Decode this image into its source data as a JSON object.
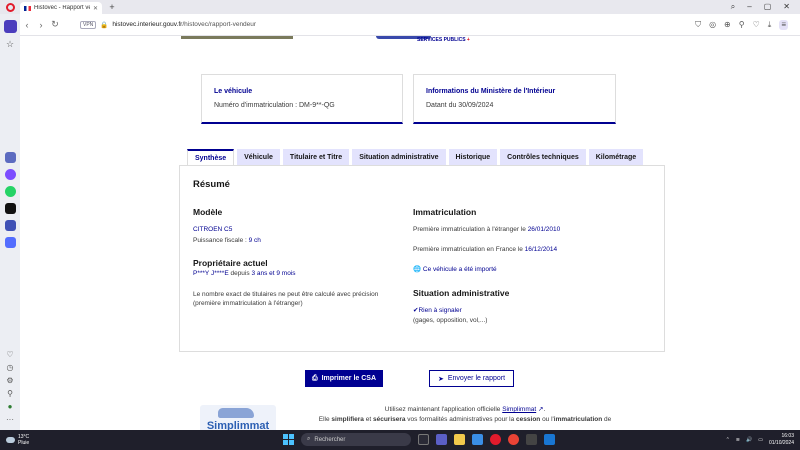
{
  "browser": {
    "tab_title": "Histovec - Rapport vende",
    "url_badge": "VPN",
    "url_domain": "histovec.interieur.gouv.fr",
    "url_path": "/histovec/rapport-vendeur"
  },
  "header": {
    "services_publics_logo": "SERVICES PUBLICS"
  },
  "cards": [
    {
      "title": "Le véhicule",
      "value": "Numéro d'immatriculation : DM-9**-QG"
    },
    {
      "title": "Informations du Ministère de l'Intérieur",
      "value": "Datant du 30/09/2024"
    }
  ],
  "tabs": [
    "Synthèse",
    "Véhicule",
    "Titulaire et Titre",
    "Situation administrative",
    "Historique",
    "Contrôles techniques",
    "Kilométrage"
  ],
  "panel": {
    "resume": "Résumé",
    "modele": {
      "heading": "Modèle",
      "name": "CITROEN C5",
      "puissance_label": "Puissance fiscale : ",
      "puissance_value": "9 ch"
    },
    "proprietaire": {
      "heading": "Propriétaire actuel",
      "name": "P***Y J****E",
      "since_prefix": " depuis ",
      "since_value": "3 ans et 9 mois",
      "note": "Le nombre exact de titulaires ne peut être calculé avec précision (première immatriculation à l'étranger)"
    },
    "immatriculation": {
      "heading": "Immatriculation",
      "line1_label": "Première immatriculation à l'étranger le ",
      "line1_date": "26/01/2010",
      "line2_label": "Première immatriculation en France le ",
      "line2_date": "16/12/2014",
      "imported": "Ce véhicule a été importé"
    },
    "situation": {
      "heading": "Situation administrative",
      "status": "Rien à signaler",
      "detail": "(gages, opposition, vol,...)"
    }
  },
  "actions": {
    "print": "Imprimer le CSA",
    "send": "Envoyer le rapport"
  },
  "simplimmat": {
    "logo_text": "Simplimmat",
    "p1": "Utilisez maintenant l'application officielle ",
    "link": "Simplimmat",
    "p2": "Elle ",
    "b1": "simplifiera",
    "p3": " et ",
    "b2": "sécurisera",
    "p4": " vos formalités administratives pour la ",
    "b3": "cession",
    "p5": " ou l'",
    "b4": "immatriculation",
    "p6": " de"
  },
  "taskbar": {
    "temperature": "13°C",
    "weather": "Pluie",
    "search_placeholder": "Rechercher",
    "time": "16:03",
    "date": "01/10/2024"
  }
}
